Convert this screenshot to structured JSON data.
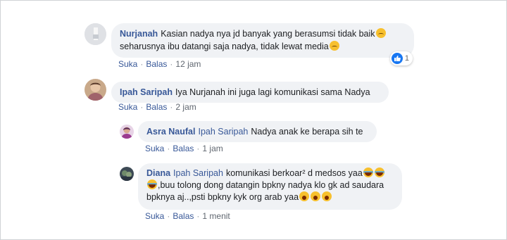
{
  "comments": [
    {
      "author": "Nurjanah",
      "line1": "Kasian nadya nya jd banyak yang berasumsi tidak baik",
      "line2": "seharusnya ibu datangi saja nadya, tidak lewat media",
      "like_label": "Suka",
      "reply_label": "Balas",
      "time": "12 jam",
      "reaction_count": "1"
    },
    {
      "author": "Ipah Saripah",
      "text": "Iya Nurjanah ini juga lagi komunikasi sama Nadya",
      "like_label": "Suka",
      "reply_label": "Balas",
      "time": "2 jam"
    },
    {
      "author": "Asra Naufal",
      "mention": "Ipah Saripah",
      "text": "Nadya anak ke berapa sih te",
      "like_label": "Suka",
      "reply_label": "Balas",
      "time": "1 jam"
    },
    {
      "author": "Diana",
      "mention": "Ipah Saripah",
      "line1": "komunikasi berkoar² d medsos yaa",
      "line2": ",buu tolong dong datangin bpkny nadya klo gk ad saudara",
      "line3": "bpknya aj..,psti bpkny kyk org arab yaa",
      "like_label": "Suka",
      "reply_label": "Balas",
      "time": "1 menit"
    }
  ]
}
